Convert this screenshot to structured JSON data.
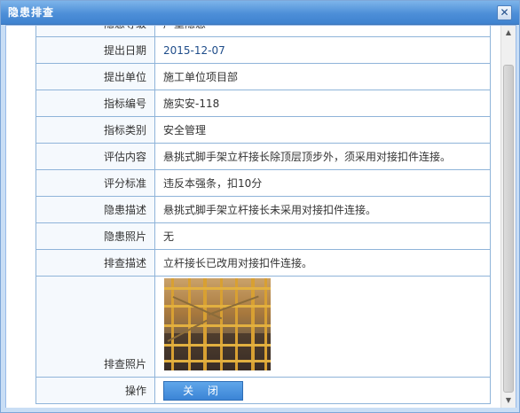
{
  "window": {
    "title": "隐患排查",
    "close_glyph": "✕"
  },
  "rows": [
    {
      "label": "隐患等级",
      "value": "严重隐患"
    },
    {
      "label": "提出日期",
      "value": "2015-12-07"
    },
    {
      "label": "提出单位",
      "value": "施工单位项目部"
    },
    {
      "label": "指标编号",
      "value": "施实安-118"
    },
    {
      "label": "指标类别",
      "value": "安全管理"
    },
    {
      "label": "评估内容",
      "value": "悬挑式脚手架立杆接长除顶层顶步外，须采用对接扣件连接。"
    },
    {
      "label": "评分标准",
      "value": "违反本强条，扣10分"
    },
    {
      "label": "隐患描述",
      "value": "悬挑式脚手架立杆接长未采用对接扣件连接。"
    },
    {
      "label": "隐患照片",
      "value": "无"
    },
    {
      "label": "排查描述",
      "value": "立杆接长已改用对接扣件连接。"
    }
  ],
  "photo_row": {
    "label": "排查照片",
    "image_name": "scaffold-photo"
  },
  "action_row": {
    "label": "操作",
    "button_label": "关 闭"
  },
  "scrollbar": {
    "up_glyph": "▲",
    "down_glyph": "▼"
  }
}
